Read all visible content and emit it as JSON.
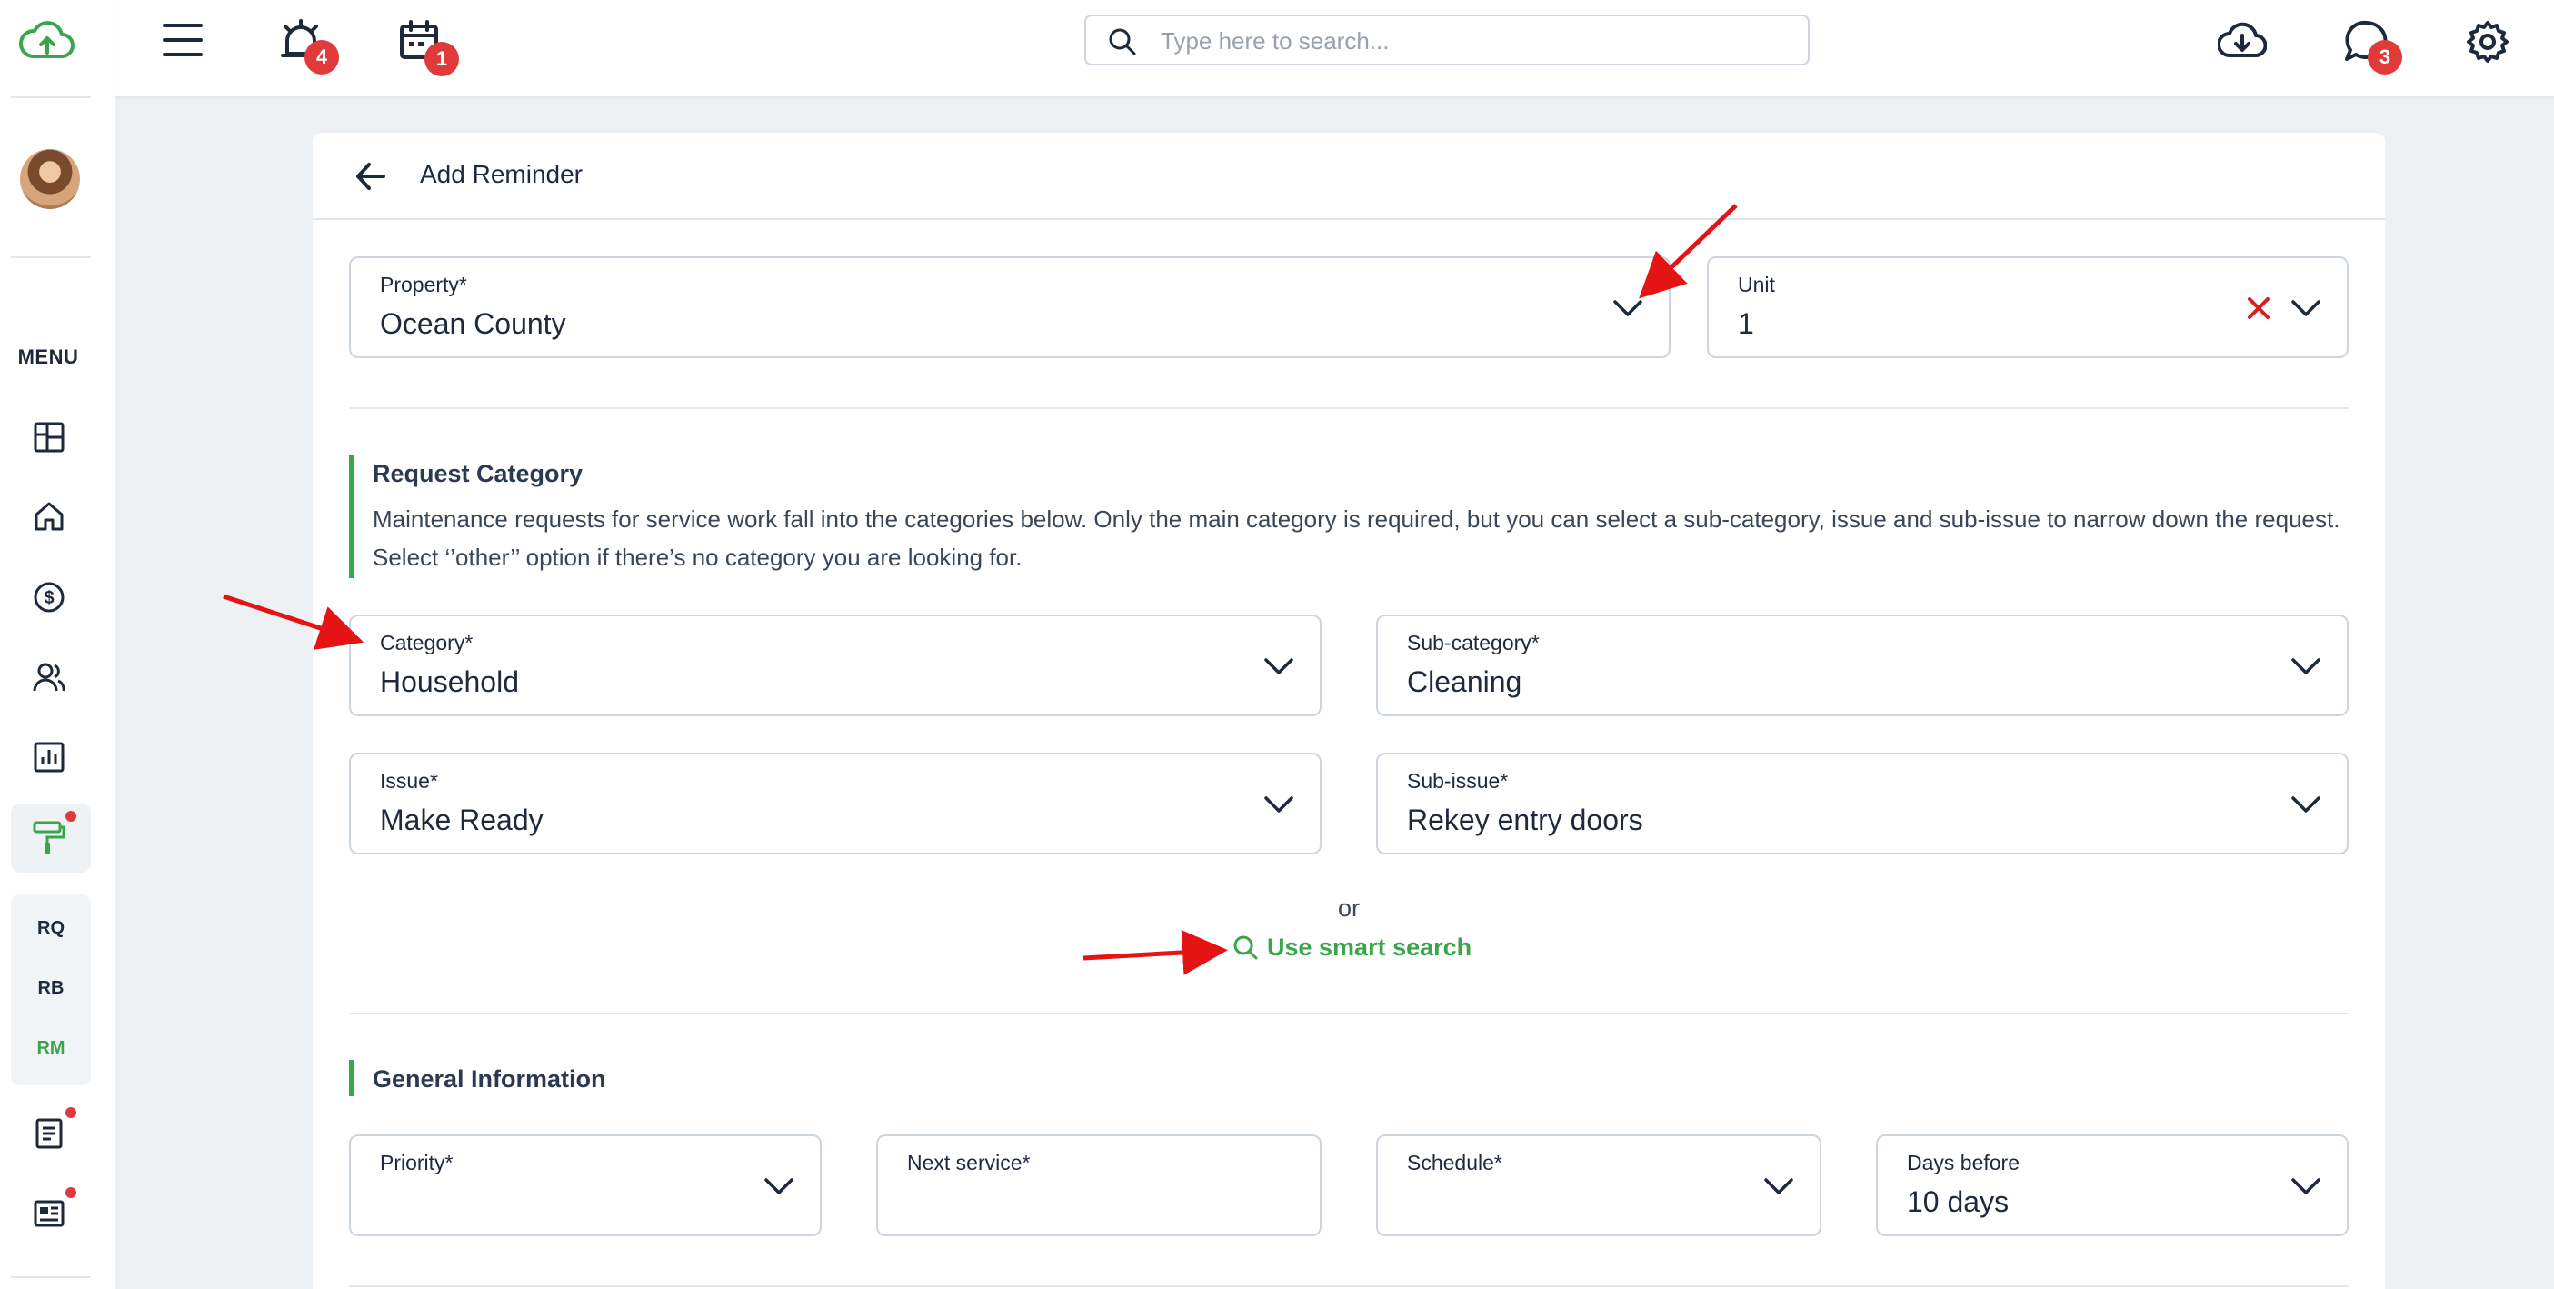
{
  "topbar": {
    "search_placeholder": "Type here to search...",
    "alarm_badge": "4",
    "calendar_badge": "1",
    "chat_badge": "3"
  },
  "sidebar": {
    "menu_label": "MENU",
    "sub_items": [
      "RQ",
      "RB",
      "RM"
    ]
  },
  "page": {
    "title": "Add Reminder"
  },
  "property": {
    "label": "Property*",
    "value": "Ocean County"
  },
  "unit": {
    "label": "Unit",
    "value": "1"
  },
  "request_category": {
    "title": "Request Category",
    "description": "Maintenance requests for service work fall into the categories below. Only the main category is required, but you can select a sub-category, issue and sub-issue to narrow down the request. Select ‘’other’’ option if there’s no category you are looking for."
  },
  "category": {
    "label": "Category*",
    "value": "Household"
  },
  "subcategory": {
    "label": "Sub-category*",
    "value": "Cleaning"
  },
  "issue": {
    "label": "Issue*",
    "value": "Make Ready"
  },
  "subissue": {
    "label": "Sub-issue*",
    "value": "Rekey entry doors"
  },
  "or_label": "or",
  "smart_search_label": "Use smart search",
  "general_info": {
    "title": "General Information"
  },
  "priority": {
    "label": "Priority*",
    "value": ""
  },
  "next_service": {
    "label": "Next service*",
    "value": ""
  },
  "schedule": {
    "label": "Schedule*",
    "value": ""
  },
  "days_before": {
    "label": "Days before",
    "value": "10 days"
  },
  "colors": {
    "accent_green": "#3aa54a",
    "badge_red": "#e03a3a",
    "annotation_arrow": "#e41414"
  }
}
